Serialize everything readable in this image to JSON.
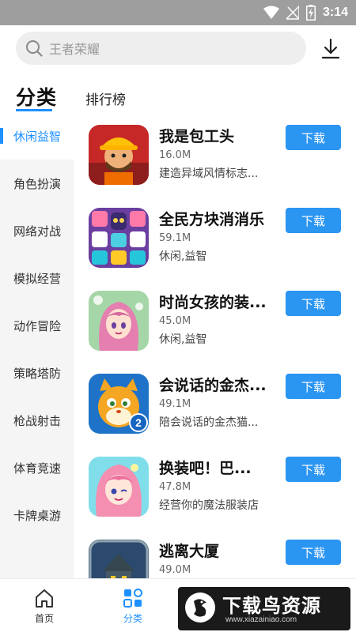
{
  "status_bar": {
    "time": "3:14",
    "icons": [
      "wifi-icon",
      "signal-icon",
      "battery-charging-icon"
    ]
  },
  "search": {
    "placeholder": "王者荣耀"
  },
  "header": {
    "title": "分类",
    "section": "排行榜"
  },
  "sidebar": {
    "items": [
      {
        "label": "休闲益智",
        "active": true
      },
      {
        "label": "角色扮演"
      },
      {
        "label": "网络对战"
      },
      {
        "label": "模拟经营"
      },
      {
        "label": "动作冒险"
      },
      {
        "label": "策略塔防"
      },
      {
        "label": "枪战射击"
      },
      {
        "label": "体育竞速"
      },
      {
        "label": "卡牌桌游"
      }
    ]
  },
  "apps": [
    {
      "name": "我是包工头",
      "size": "16.0M",
      "desc": "建造异域风情标志...",
      "button": "下载",
      "icon": "builder-game-icon"
    },
    {
      "name": "全民方块消消乐",
      "size": "59.1M",
      "desc": "休闲,益智",
      "button": "下载",
      "icon": "block-puzzle-icon"
    },
    {
      "name": "时尚女孩的装...",
      "size": "45.0M",
      "desc": "休闲,益智",
      "button": "下载",
      "icon": "fashion-girl-icon"
    },
    {
      "name": "会说话的金杰...",
      "size": "49.1M",
      "desc": "陪会说话的金杰猫...",
      "button": "下载",
      "icon": "talking-cat-icon"
    },
    {
      "name": "换装吧！巴...",
      "size": "47.8M",
      "desc": "经营你的魔法服装店",
      "button": "下载",
      "icon": "dressup-girl-icon"
    },
    {
      "name": "逃离大厦",
      "size": "49.0M",
      "desc": "",
      "button": "下载",
      "icon": "mansion-escape-icon"
    }
  ],
  "bottom_nav": [
    {
      "label": "首页",
      "icon": "home-icon"
    },
    {
      "label": "分类",
      "icon": "category-icon",
      "active": true
    }
  ],
  "watermark": {
    "title": "下载鸟资源",
    "url": "www.xiazainiao.com"
  },
  "colors": {
    "accent": "#1e90ff",
    "button": "#2b95f2",
    "status_bar": "#9e9e9e",
    "sidebar_bg": "#f5f5f5"
  }
}
